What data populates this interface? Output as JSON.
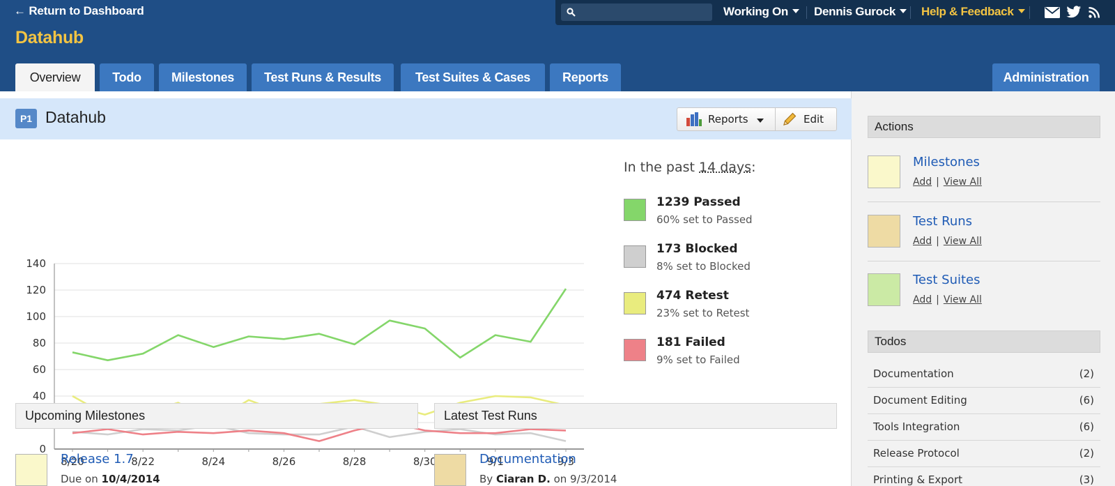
{
  "header": {
    "back_link": "← Return to Dashboard",
    "brand": "Datahub",
    "search_placeholder": "",
    "menus": [
      {
        "label": "Working On"
      },
      {
        "label": "Dennis Gurock"
      },
      {
        "label": "Help & Feedback"
      }
    ],
    "icons": [
      "mail-icon",
      "twitter-icon",
      "rss-icon"
    ],
    "tabs": [
      {
        "label": "Overview",
        "active": true
      },
      {
        "label": "Todo"
      },
      {
        "label": "Milestones"
      },
      {
        "label": "Test Runs & Results"
      },
      {
        "label": "Test Suites & Cases"
      },
      {
        "label": "Reports"
      }
    ],
    "admin_tab": "Administration"
  },
  "page": {
    "badge": "P1",
    "title": "Datahub",
    "reports_button": "Reports",
    "edit_button": "Edit"
  },
  "chart_data": {
    "type": "line",
    "x": [
      "8/20",
      "8/21",
      "8/22",
      "8/23",
      "8/24",
      "8/25",
      "8/26",
      "8/27",
      "8/28",
      "8/29",
      "8/30",
      "8/31",
      "9/1",
      "9/2",
      "9/3"
    ],
    "x_tick_labels": [
      "8/20",
      "8/22",
      "8/24",
      "8/26",
      "8/28",
      "8/30",
      "9/1",
      "9/3"
    ],
    "ylim": [
      0,
      140
    ],
    "y_ticks": [
      0,
      20,
      40,
      60,
      80,
      100,
      120,
      140
    ],
    "grid": true,
    "series": [
      {
        "name": "Passed",
        "color": "#84d66a",
        "values": [
          73,
          67,
          72,
          86,
          77,
          85,
          83,
          87,
          79,
          97,
          91,
          69,
          86,
          81,
          121
        ]
      },
      {
        "name": "Retest",
        "color": "#e9ec7e",
        "values": [
          40,
          25,
          27,
          35,
          21,
          37,
          27,
          34,
          37,
          33,
          26,
          35,
          40,
          39,
          33
        ]
      },
      {
        "name": "Blocked",
        "color": "#cfcfcf",
        "values": [
          13,
          11,
          15,
          14,
          18,
          12,
          11,
          11,
          17,
          9,
          13,
          15,
          11,
          12,
          6
        ]
      },
      {
        "name": "Failed",
        "color": "#ee8188",
        "values": [
          12,
          15,
          11,
          13,
          12,
          14,
          12,
          6,
          14,
          20,
          14,
          12,
          12,
          15,
          14
        ]
      }
    ]
  },
  "legend": {
    "title_prefix": "In the past",
    "title_period": "14 days",
    "title_suffix": ":",
    "items": [
      {
        "count": "1239 Passed",
        "desc": "60% set to Passed",
        "color": "#84d66a"
      },
      {
        "count": "173 Blocked",
        "desc": "8% set to Blocked",
        "color": "#cfcfcf"
      },
      {
        "count": "474 Retest",
        "desc": "23% set to Retest",
        "color": "#e9ec7e"
      },
      {
        "count": "181 Failed",
        "desc": "9% set to Failed",
        "color": "#ee8188"
      }
    ]
  },
  "milestones": {
    "heading": "Upcoming Milestones",
    "items": [
      {
        "title": "Release 1.7",
        "sub_prefix": "Due on",
        "sub_value": "10/4/2014",
        "color": "#faf8cb"
      }
    ]
  },
  "runs": {
    "heading": "Latest Test Runs",
    "items": [
      {
        "title": "Documentation",
        "sub_prefix": "By",
        "sub_value": "Ciaran D.",
        "sub_mid": "on",
        "sub_date": "9/3/2014",
        "color": "#eedba4"
      }
    ]
  },
  "sidebar": {
    "actions_heading": "Actions",
    "actions": [
      {
        "title": "Milestones",
        "add": "Add",
        "sep": "|",
        "view": "View All",
        "color": "#faf8cb"
      },
      {
        "title": "Test Runs",
        "add": "Add",
        "sep": "|",
        "view": "View All",
        "color": "#eedba4"
      },
      {
        "title": "Test Suites",
        "add": "Add",
        "sep": "|",
        "view": "View All",
        "color": "#cbeaa5"
      }
    ],
    "todos_heading": "Todos",
    "todos": [
      {
        "name": "Documentation",
        "count": "(2)"
      },
      {
        "name": "Document Editing",
        "count": "(6)"
      },
      {
        "name": "Tools Integration",
        "count": "(6)"
      },
      {
        "name": "Release Protocol",
        "count": "(2)"
      },
      {
        "name": "Printing & Export",
        "count": "(3)"
      }
    ]
  }
}
